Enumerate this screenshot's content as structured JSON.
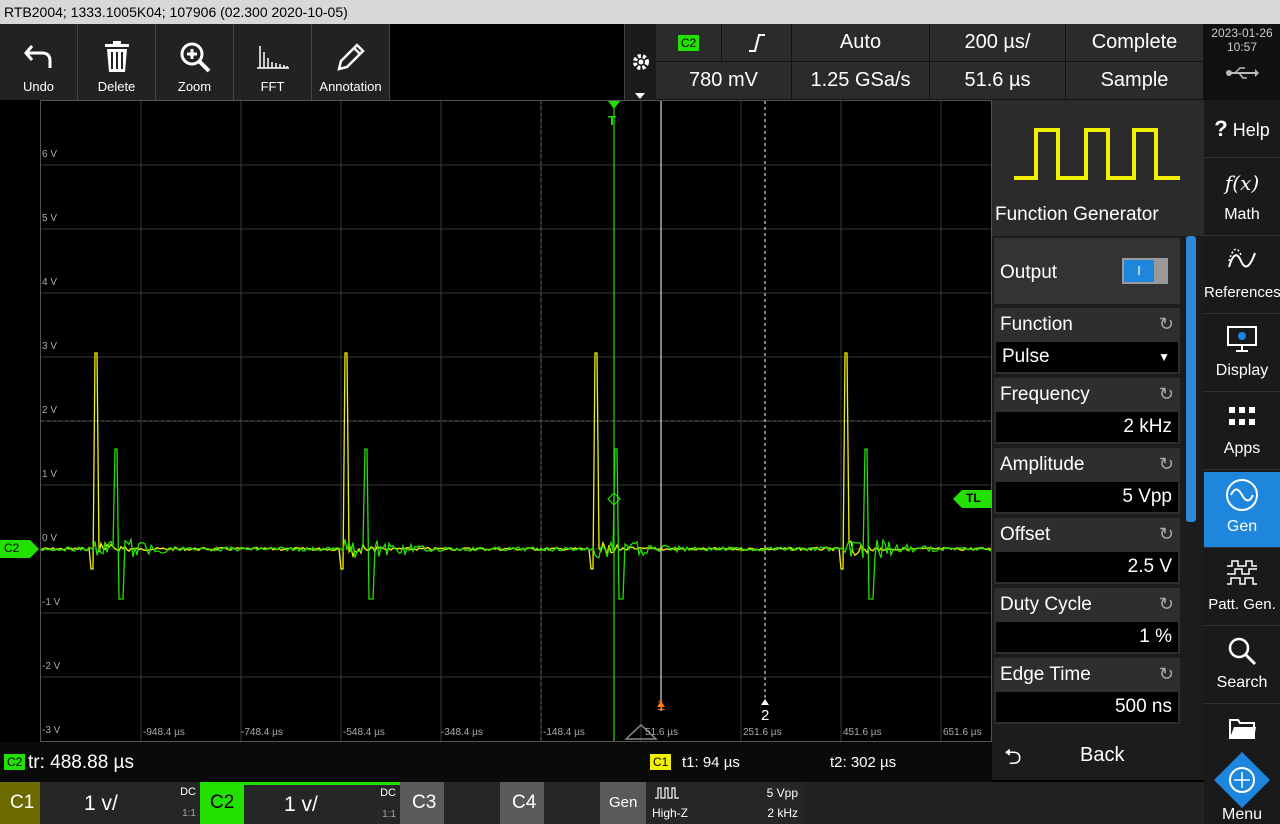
{
  "title": "RTB2004; 1333.1005K04; 107906 (02.300 2020-10-05)",
  "toolbar": {
    "undo": "Undo",
    "delete": "Delete",
    "zoom": "Zoom",
    "fft": "FFT",
    "annotation": "Annotation"
  },
  "acquisition": {
    "channel": "C2",
    "edge": "rising",
    "trigger_mode": "Auto",
    "timebase": "200 µs/",
    "acq_state": "Complete",
    "trigger_level": "780 mV",
    "sample_rate": "1.25 GSa/s",
    "position": "51.6 µs",
    "acq_mode": "Sample"
  },
  "datetime": {
    "date": "2023-01-26",
    "time": "10:57"
  },
  "grid": {
    "y_labels": [
      "6 V",
      "5 V",
      "4 V",
      "3 V",
      "2 V",
      "1 V",
      "0 V",
      "-1 V",
      "-2 V",
      "-3 V"
    ],
    "x_labels": [
      "-948.4 µs",
      "-748.4 µs",
      "-548.4 µs",
      "-348.4 µs",
      "-148.4 µs",
      "51.6 µs",
      "251.6 µs",
      "451.6 µs",
      "651.6 µs"
    ],
    "ch_marker": "C2",
    "trigger_level_marker": "TL",
    "cursor1": "1",
    "cursor2": "2",
    "trigger_marker": "T"
  },
  "function_generator": {
    "title": "Function Generator",
    "output_label": "Output",
    "output_state": "I",
    "params": [
      {
        "label": "Function",
        "value": "Pulse"
      },
      {
        "label": "Frequency",
        "value": "2 kHz"
      },
      {
        "label": "Amplitude",
        "value": "5 Vpp"
      },
      {
        "label": "Offset",
        "value": "2.5 V"
      },
      {
        "label": "Duty Cycle",
        "value": "1 %"
      },
      {
        "label": "Edge Time",
        "value": "500 ns"
      }
    ],
    "back": "Back"
  },
  "side_menu": {
    "help": "Help",
    "math": "Math",
    "references": "References",
    "display": "Display",
    "apps": "Apps",
    "gen": "Gen",
    "patt_gen": "Patt. Gen.",
    "search": "Search",
    "menu": "Menu"
  },
  "status": {
    "meas_channel": "C2",
    "meas": "tr: 488.88 µs",
    "cursor_channel": "C1",
    "t1": "t1: 94 µs",
    "t2": "t2: 302 µs"
  },
  "channels": {
    "c1": {
      "name": "C1",
      "scale": "1 v/",
      "coupling": "DC",
      "ratio": "1:1"
    },
    "c2": {
      "name": "C2",
      "scale": "1 v/",
      "coupling": "DC",
      "ratio": "1:1"
    },
    "c3": {
      "name": "C3"
    },
    "c4": {
      "name": "C4"
    },
    "gen": {
      "name": "Gen",
      "amplitude": "5 Vpp",
      "impedance": "High-Z",
      "frequency": "2 kHz"
    }
  },
  "colors": {
    "ch1": "#f2f200",
    "ch2": "#22e000",
    "accent": "#1e86dd",
    "cursor1": "#ff7a1a"
  }
}
